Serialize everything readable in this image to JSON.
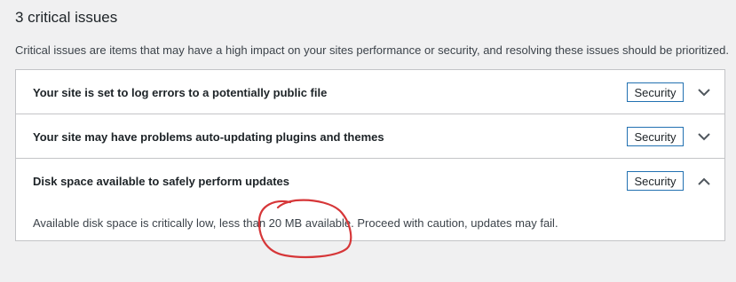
{
  "section": {
    "heading": "3 critical issues",
    "description": "Critical issues are items that may have a high impact on your sites performance or security, and resolving these issues should be prioritized."
  },
  "issues": [
    {
      "title": "Your site is set to log errors to a potentially public file",
      "badge": "Security",
      "expanded": false,
      "toggle_icon": "chevron-down-icon"
    },
    {
      "title": "Your site may have problems auto-updating plugins and themes",
      "badge": "Security",
      "expanded": false,
      "toggle_icon": "chevron-down-icon"
    },
    {
      "title": "Disk space available to safely perform updates",
      "badge": "Security",
      "expanded": true,
      "toggle_icon": "chevron-up-icon",
      "detail": "Available disk space is critically low, less than 20 MB available. Proceed with caution, updates may fail."
    }
  ],
  "colors": {
    "badge_border": "#2271b1",
    "annotation": "#d63638",
    "panel_border": "#c3c4c7",
    "background": "#f0f0f1"
  }
}
